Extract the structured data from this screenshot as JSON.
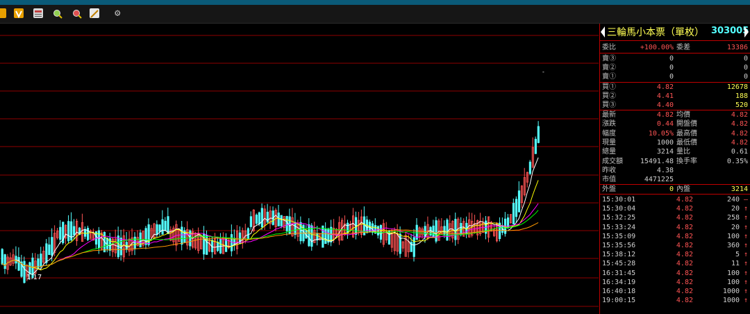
{
  "stock": {
    "name": "三輪馬小本票（單枚）",
    "code": "303005"
  },
  "toolbar": {
    "icons": [
      "folder-icon",
      "v-badge-icon",
      "report-icon",
      "zoom-in-icon",
      "zoom-out-icon",
      "draw-line-icon",
      "gear-icon"
    ]
  },
  "chart": {
    "low_label": "1.17"
  },
  "ratio": {
    "label1": "委比",
    "value1": "+100.00%",
    "label2": "委差",
    "value2": "13386"
  },
  "asks": [
    {
      "label": "賣③",
      "price": "0",
      "volume": "0"
    },
    {
      "label": "賣②",
      "price": "0",
      "volume": "0"
    },
    {
      "label": "賣①",
      "price": "0",
      "volume": "0"
    }
  ],
  "bids": [
    {
      "label": "買①",
      "price": "4.82",
      "volume": "12678"
    },
    {
      "label": "買②",
      "price": "4.41",
      "volume": "188"
    },
    {
      "label": "買③",
      "price": "4.40",
      "volume": "520"
    }
  ],
  "stats": [
    {
      "l1": "最新",
      "v1": "4.82",
      "c1": "red",
      "l2": "均價",
      "v2": "4.82",
      "c2": "red"
    },
    {
      "l1": "漲跌",
      "v1": "0.44",
      "c1": "red",
      "l2": "開盤價",
      "v2": "4.82",
      "c2": "red"
    },
    {
      "l1": "幅度",
      "v1": "10.05%",
      "c1": "red",
      "l2": "最高價",
      "v2": "4.82",
      "c2": "red"
    },
    {
      "l1": "現量",
      "v1": "1000",
      "c1": "wht",
      "l2": "最低價",
      "v2": "4.82",
      "c2": "red"
    },
    {
      "l1": "總量",
      "v1": "3214",
      "c1": "wht",
      "l2": "量比",
      "v2": "0.61",
      "c2": "wht"
    },
    {
      "l1": "成交額",
      "v1": "15491.48",
      "c1": "wht",
      "l2": "換手率",
      "v2": "0.35%",
      "c2": "wht"
    },
    {
      "l1": "昨收",
      "v1": "4.38",
      "c1": "wht",
      "l2": "",
      "v2": "",
      "c2": "wht"
    },
    {
      "l1": "市值",
      "v1": "4471225",
      "c1": "wht",
      "l2": "",
      "v2": "",
      "c2": "wht"
    }
  ],
  "outer_inner": {
    "out_label": "外盤",
    "out_value": "0",
    "in_label": "內盤",
    "in_value": "3214"
  },
  "ticks": [
    {
      "time": "15:30:01",
      "price": "4.82",
      "vol": "240",
      "flag": "—"
    },
    {
      "time": "15:30:04",
      "price": "4.82",
      "vol": "20",
      "flag": "↑"
    },
    {
      "time": "15:32:25",
      "price": "4.82",
      "vol": "258",
      "flag": "↑"
    },
    {
      "time": "15:33:24",
      "price": "4.82",
      "vol": "20",
      "flag": "↑"
    },
    {
      "time": "15:35:09",
      "price": "4.82",
      "vol": "100",
      "flag": "↑"
    },
    {
      "time": "15:35:56",
      "price": "4.82",
      "vol": "360",
      "flag": "↑"
    },
    {
      "time": "15:38:12",
      "price": "4.82",
      "vol": "5",
      "flag": "↑"
    },
    {
      "time": "15:45:28",
      "price": "4.82",
      "vol": "11",
      "flag": "↑"
    },
    {
      "time": "16:31:45",
      "price": "4.82",
      "vol": "100",
      "flag": "↑"
    },
    {
      "time": "16:34:19",
      "price": "4.82",
      "vol": "100",
      "flag": "↑"
    },
    {
      "time": "16:40:18",
      "price": "4.82",
      "vol": "1000",
      "flag": "↑"
    },
    {
      "time": "19:00:15",
      "price": "4.82",
      "vol": "1000",
      "flag": "↑"
    }
  ],
  "colors": {
    "up": "#ff5454",
    "down": "#54ffff",
    "grid": "#c00000",
    "ma5": "#ffffff",
    "ma10": "#ffff00",
    "ma20": "#ff00ff",
    "ma30": "#00ff00",
    "ma60": "#ff9900"
  }
}
